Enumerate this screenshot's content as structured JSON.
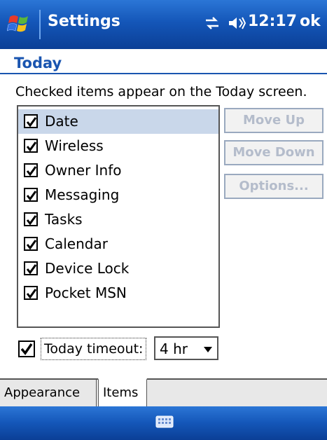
{
  "titlebar": {
    "title": "Settings",
    "time": "12:17",
    "ok_label": "ok",
    "icons": [
      "start-logo-icon",
      "connectivity-icon",
      "volume-icon"
    ],
    "color": "#1456b8"
  },
  "page": {
    "title": "Today",
    "description": "Checked items appear on the Today screen."
  },
  "list": {
    "items": [
      {
        "label": "Date",
        "checked": true,
        "selected": true
      },
      {
        "label": "Wireless",
        "checked": true
      },
      {
        "label": "Owner Info",
        "checked": true
      },
      {
        "label": "Messaging",
        "checked": true
      },
      {
        "label": "Tasks",
        "checked": true
      },
      {
        "label": "Calendar",
        "checked": true
      },
      {
        "label": "Device Lock",
        "checked": true
      },
      {
        "label": "Pocket MSN",
        "checked": true
      }
    ]
  },
  "buttons": {
    "move_up": "Move Up",
    "move_down": "Move Down",
    "options": "Options..."
  },
  "timeout": {
    "checked": true,
    "label": "Today timeout:",
    "value": "4 hr"
  },
  "tabs": [
    {
      "label": "Appearance",
      "active": false
    },
    {
      "label": "Items",
      "active": true
    }
  ],
  "menubar": {
    "icon": "keyboard-icon"
  }
}
